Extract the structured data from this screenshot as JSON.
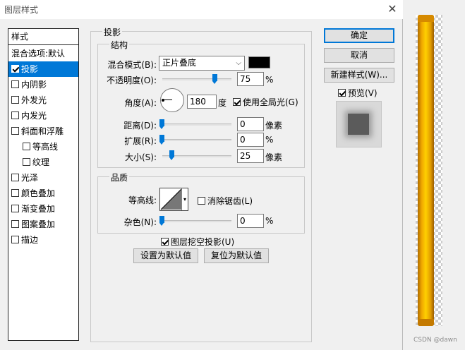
{
  "window": {
    "title": "图层样式"
  },
  "style_list": {
    "header": "样式",
    "items": [
      {
        "label": "混合选项:默认",
        "checkbox": false,
        "checked": false,
        "selected": false,
        "indent": false
      },
      {
        "label": "投影",
        "checkbox": true,
        "checked": true,
        "selected": true,
        "indent": false
      },
      {
        "label": "内阴影",
        "checkbox": true,
        "checked": false,
        "selected": false,
        "indent": false
      },
      {
        "label": "外发光",
        "checkbox": true,
        "checked": false,
        "selected": false,
        "indent": false
      },
      {
        "label": "内发光",
        "checkbox": true,
        "checked": false,
        "selected": false,
        "indent": false
      },
      {
        "label": "斜面和浮雕",
        "checkbox": true,
        "checked": false,
        "selected": false,
        "indent": false
      },
      {
        "label": "等高线",
        "checkbox": true,
        "checked": false,
        "selected": false,
        "indent": true
      },
      {
        "label": "纹理",
        "checkbox": true,
        "checked": false,
        "selected": false,
        "indent": true
      },
      {
        "label": "光泽",
        "checkbox": true,
        "checked": false,
        "selected": false,
        "indent": false
      },
      {
        "label": "颜色叠加",
        "checkbox": true,
        "checked": false,
        "selected": false,
        "indent": false
      },
      {
        "label": "渐变叠加",
        "checkbox": true,
        "checked": false,
        "selected": false,
        "indent": false
      },
      {
        "label": "图案叠加",
        "checkbox": true,
        "checked": false,
        "selected": false,
        "indent": false
      },
      {
        "label": "描边",
        "checkbox": true,
        "checked": false,
        "selected": false,
        "indent": false
      }
    ]
  },
  "drop_shadow": {
    "title": "投影",
    "structure": {
      "title": "结构",
      "blend_mode_label": "混合模式(B):",
      "blend_mode_value": "正片叠底",
      "shadow_color": "#000000",
      "opacity_label": "不透明度(O):",
      "opacity_value": "75",
      "opacity_unit": "%",
      "opacity_fraction": 0.75,
      "angle_label": "角度(A):",
      "angle_value": "180",
      "angle_unit": "度",
      "global_light_label": "使用全局光(G)",
      "global_light_checked": true,
      "distance_label": "距离(D):",
      "distance_value": "0",
      "distance_unit": "像素",
      "spread_label": "扩展(R):",
      "spread_value": "0",
      "spread_unit": "%",
      "size_label": "大小(S):",
      "size_value": "25",
      "size_unit": "像素"
    },
    "quality": {
      "title": "品质",
      "contour_label": "等高线:",
      "anti_alias_label": "消除锯齿(L)",
      "anti_alias_checked": false,
      "noise_label": "杂色(N):",
      "noise_value": "0",
      "noise_unit": "%"
    },
    "knockout_label": "图层挖空投影(U)",
    "knockout_checked": true,
    "make_default_label": "设置为默认值",
    "reset_default_label": "复位为默认值"
  },
  "buttons": {
    "ok": "确定",
    "cancel": "取消",
    "new_style": "新建样式(W)..."
  },
  "preview": {
    "label": "预览(V)",
    "checked": true
  },
  "watermark": "CSDN @dawn",
  "colors": {
    "accent": "#0078d7",
    "gold": "#f0a800"
  }
}
